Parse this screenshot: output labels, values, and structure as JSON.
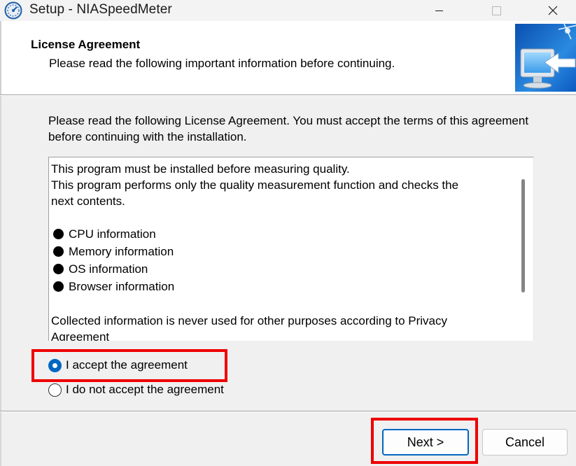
{
  "window": {
    "title": "Setup - NIASpeedMeter",
    "icon": "speedometer-icon",
    "controls": [
      "minimize-icon",
      "maximize-icon",
      "close-icon"
    ]
  },
  "header": {
    "title": "License Agreement",
    "subtitle": "Please read the following important information before continuing."
  },
  "instructions": "Please read the following License Agreement. You must accept the terms of this agreement before continuing with the installation.",
  "license": {
    "lines": [
      "This program must be installed before measuring quality.",
      "This program performs only the quality measurement function and checks the",
      "next contents."
    ],
    "bullets": [
      "CPU information",
      "Memory information",
      "OS information",
      "Browser information"
    ],
    "after_lines": [
      "Collected information is never used for other purposes according to Privacy",
      "Agreement"
    ]
  },
  "options": {
    "accept": "I accept the agreement",
    "reject": "I do not accept the agreement",
    "selected": "accept"
  },
  "buttons": {
    "next": "Next >",
    "cancel": "Cancel"
  },
  "colors": {
    "accent": "#0067c0",
    "highlight": "#ee0000"
  }
}
